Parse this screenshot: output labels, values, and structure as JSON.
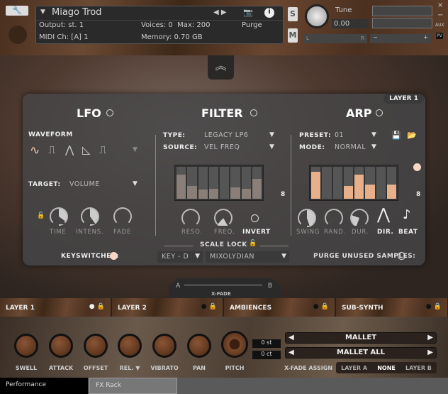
{
  "header": {
    "instrument_name": "Miago Trod",
    "output_label": "Output:",
    "output_value": "st. 1",
    "midi_label": "MIDI Ch:",
    "midi_value": "[A]  1",
    "voices_label": "Voices:",
    "voices_value": "0",
    "max_label": "Max:",
    "max_value": "200",
    "memory_label": "Memory:",
    "memory_value": "0.70 GB",
    "purge_label": "Purge",
    "solo_label": "S",
    "mute_label": "M",
    "tune_label": "Tune",
    "tune_value": "0.00",
    "pan_left": "L",
    "pan_right": "R",
    "vol_minus": "−",
    "vol_plus": "+",
    "aux_label": "AUX",
    "pv_label": "PV",
    "close_label": "×",
    "minimize_label": "−"
  },
  "panel": {
    "layer_badge": "LAYER 1",
    "lfo": {
      "title": "LFO",
      "waveform_label": "WAVEFORM",
      "target_label": "TARGET:",
      "target_value": "VOLUME",
      "knobs": [
        "TIME",
        "INTENS.",
        "FADE"
      ],
      "keyswitches_label": "KEYSWITCHES:"
    },
    "filter": {
      "title": "FILTER",
      "type_label": "TYPE:",
      "type_value": "LEGACY LP6",
      "source_label": "SOURCE:",
      "source_value": "VEL FREQ",
      "steps": [
        0.75,
        0.4,
        0.3,
        0.32,
        0,
        0.35,
        0.32,
        0.62
      ],
      "step_count": "8",
      "knobs": [
        "RESO.",
        "FREQ."
      ],
      "invert_label": "INVERT"
    },
    "arp": {
      "title": "ARP",
      "preset_label": "PRESET:",
      "preset_value": "01",
      "mode_label": "MODE:",
      "mode_value": "NORMAL",
      "steps": [
        0.85,
        0,
        0,
        0.4,
        0.75,
        0.45,
        0,
        0.45
      ],
      "step_count": "8",
      "knobs": [
        "SWING",
        "RAND.",
        "DUR."
      ],
      "dir_label": "DIR.",
      "beat_label": "BEAT",
      "purge_label": "PURGE UNUSED SAMPLES:"
    },
    "scale_lock": {
      "label": "SCALE LOCK",
      "key_value": "KEY - D",
      "scale_value": "MIXOLYDIAN"
    }
  },
  "xfade": {
    "label": "X-FADE",
    "a": "A",
    "b": "B"
  },
  "layers": [
    "LAYER 1",
    "LAYER 2",
    "AMBIENCES",
    "SUB-SYNTH"
  ],
  "bottom": {
    "knobs": [
      "SWELL",
      "ATTACK",
      "OFFSET",
      "REL. ▼",
      "VIBRATO",
      "PAN",
      "PITCH"
    ],
    "semitones": "0 st",
    "cents": "0 ct",
    "preset1": "MALLET",
    "preset2": "MALLET ALL",
    "xfade_assign_label": "X-FADE ASSIGN",
    "xfade_options": [
      "LAYER A",
      "NONE",
      "LAYER B"
    ]
  },
  "tabs": {
    "performance": "Performance",
    "fx_rack": "FX Rack"
  },
  "colors": {
    "accent": "#e8b08a"
  }
}
